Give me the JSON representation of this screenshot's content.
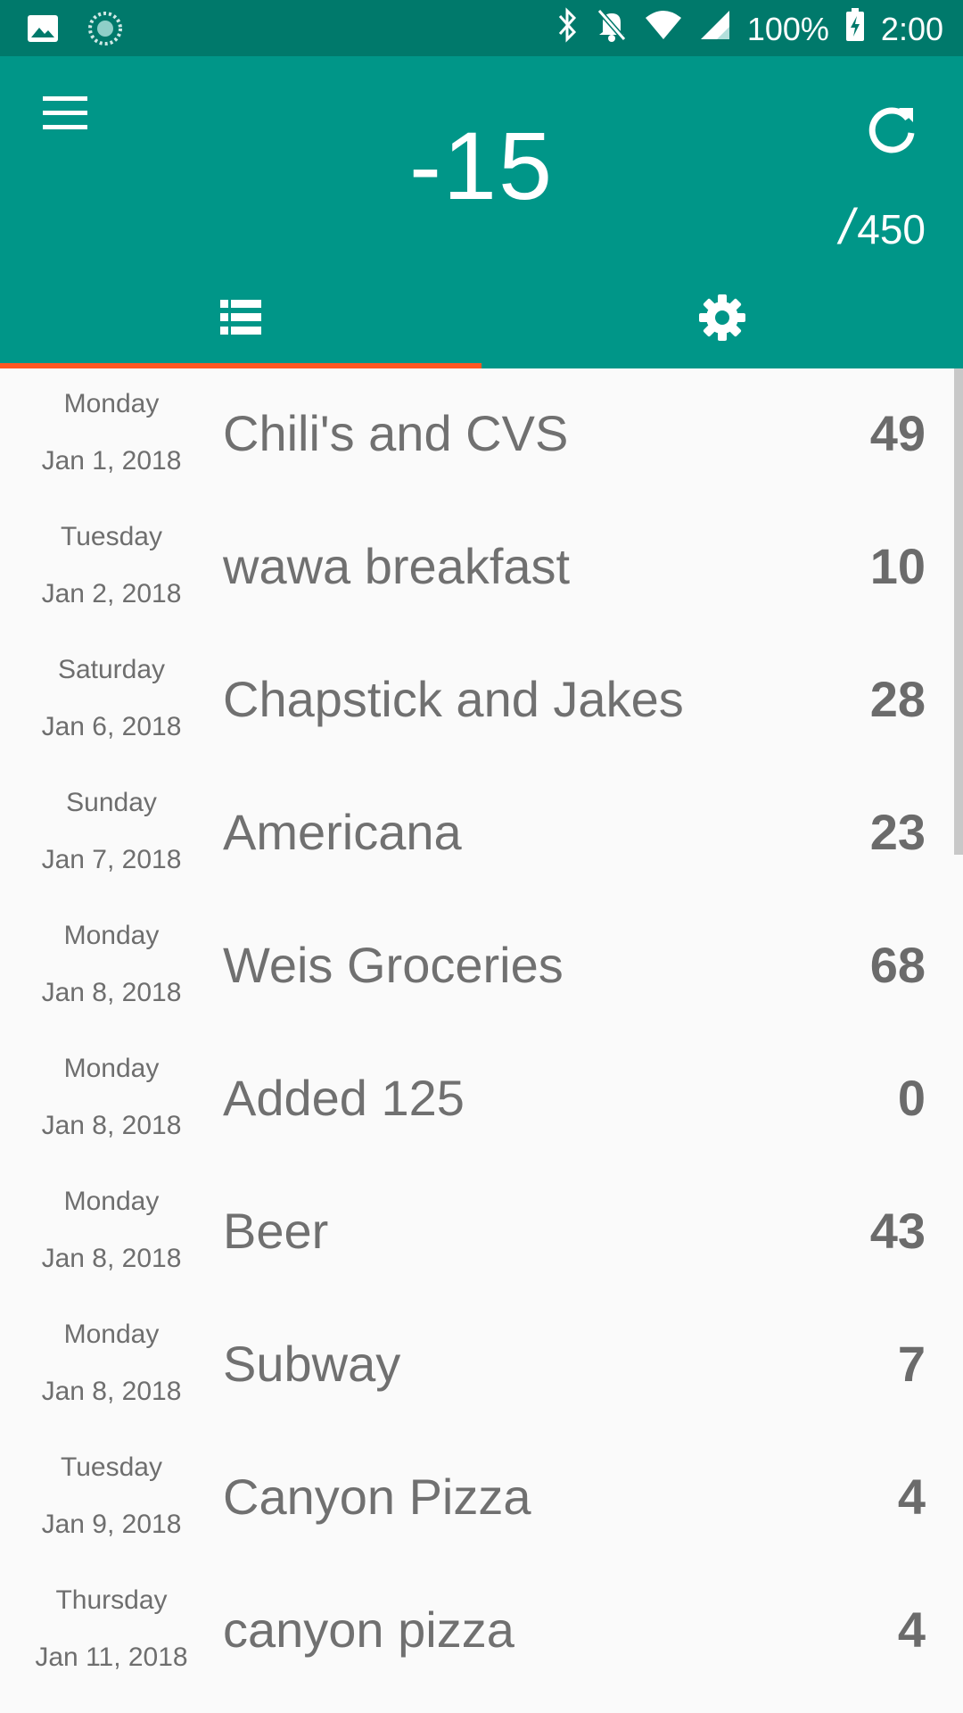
{
  "status_bar": {
    "battery": "100%",
    "time": "2:00",
    "icons": [
      "image-icon",
      "loading-icon",
      "bluetooth-icon",
      "mute-bell-icon",
      "wifi-icon",
      "signal-icon",
      "battery-charging-icon"
    ]
  },
  "header": {
    "balance": "-15",
    "budget_slash": "/",
    "budget": "450",
    "menu_icon": "hamburger-menu-icon",
    "refresh_icon": "refresh-icon"
  },
  "tabs": [
    {
      "name": "list",
      "icon": "list-icon",
      "selected": true
    },
    {
      "name": "settings",
      "icon": "gear-icon",
      "selected": false
    }
  ],
  "colors": {
    "primary": "#009688",
    "primary_dark": "#00796b",
    "accent": "#ff5722",
    "background": "#fafafa",
    "text": "#707070"
  },
  "transactions": [
    {
      "day": "Monday",
      "date": "Jan 1, 2018",
      "title": "Chili's and CVS",
      "amount": "49"
    },
    {
      "day": "Tuesday",
      "date": "Jan 2, 2018",
      "title": "wawa breakfast",
      "amount": "10"
    },
    {
      "day": "Saturday",
      "date": "Jan 6, 2018",
      "title": "Chapstick and Jakes",
      "amount": "28"
    },
    {
      "day": "Sunday",
      "date": "Jan 7, 2018",
      "title": "Americana",
      "amount": "23"
    },
    {
      "day": "Monday",
      "date": "Jan 8, 2018",
      "title": "Weis Groceries",
      "amount": "68"
    },
    {
      "day": "Monday",
      "date": "Jan 8, 2018",
      "title": "Added 125",
      "amount": "0"
    },
    {
      "day": "Monday",
      "date": "Jan 8, 2018",
      "title": "Beer",
      "amount": "43"
    },
    {
      "day": "Monday",
      "date": "Jan 8, 2018",
      "title": "Subway",
      "amount": "7"
    },
    {
      "day": "Tuesday",
      "date": "Jan 9, 2018",
      "title": "Canyon Pizza",
      "amount": "4"
    },
    {
      "day": "Thursday",
      "date": "Jan 11, 2018",
      "title": " canyon pizza",
      "amount": "4"
    }
  ]
}
